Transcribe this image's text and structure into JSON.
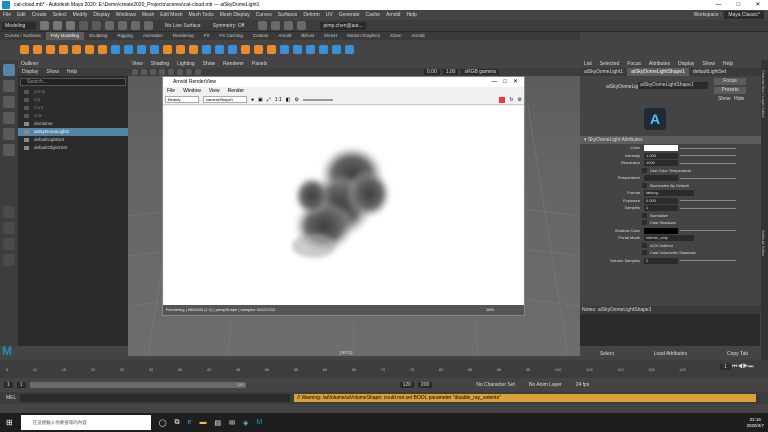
{
  "window": {
    "title": "cat-cloud.mb* - Autodesk Maya 2020: E:\\Demo\\create2020_Projects\\scenes\\cat-cloud.mb --- aiSkyDomeLight1",
    "minimize": "—",
    "maximize": "□",
    "close": "✕"
  },
  "menubar": [
    "File",
    "Edit",
    "Create",
    "Select",
    "Modify",
    "Display",
    "Windows",
    "Mesh",
    "Edit Mesh",
    "Mesh Tools",
    "Mesh Display",
    "Curves",
    "Surfaces",
    "Deform",
    "UV",
    "Generate",
    "Cache",
    "Arnold",
    "Help"
  ],
  "workspace": {
    "label": "Workspace :",
    "value": "Maya Classic*"
  },
  "status": {
    "menuset": "Modeling",
    "surface": "No Live Surface",
    "symmetry": "Symmetry: Off",
    "user": "pimp.chen@aut..."
  },
  "shelf": {
    "tabs": [
      "Curves / Surfaces",
      "Poly Modeling",
      "Sculpting",
      "Rigging",
      "Animation",
      "Rendering",
      "FX",
      "FX Caching",
      "Custom",
      "Arnold",
      "Bifrost",
      "MASH",
      "Motion Graphics",
      "XGen",
      "Arnold"
    ],
    "active": 1
  },
  "outliner": {
    "title": "Outliner",
    "menu": [
      "Display",
      "Show",
      "Help"
    ],
    "search": "Search...",
    "items": [
      {
        "label": "persp",
        "state": "dim"
      },
      {
        "label": "top",
        "state": "dim"
      },
      {
        "label": "front",
        "state": "dim"
      },
      {
        "label": "side",
        "state": "dim"
      },
      {
        "label": "aiVolume",
        "state": "lit"
      },
      {
        "label": "aiSkyDomeLight1",
        "state": "on"
      },
      {
        "label": "defaultLightSet",
        "state": "lit"
      },
      {
        "label": "defaultObjectSet",
        "state": "lit"
      }
    ]
  },
  "viewport": {
    "menu": [
      "View",
      "Shading",
      "Lighting",
      "Show",
      "Renderer",
      "Panels"
    ],
    "camera_label": "persp",
    "exposure": "0.00",
    "gamma": "1.00",
    "colorspace": "sRGB gamma"
  },
  "renderview": {
    "title": "Arnold RenderView",
    "menu": [
      "File",
      "Window",
      "View",
      "Render"
    ],
    "mode": "Beauty",
    "camera": "cameraShape1",
    "ratio": "1:1",
    "status": "Rendering | 960x540 (1:1) | perspShape | samples 3/2/2/2/2/2",
    "zoom": "16%"
  },
  "attr_editor": {
    "menu": [
      "List",
      "Selected",
      "Focus",
      "Attributes",
      "Display",
      "Show",
      "Help"
    ],
    "tabs": [
      "aiSkyDomeLight1",
      "aiSkyDomeLightShape1",
      "defaultLightSet"
    ],
    "active_tab": 1,
    "node_label": "aiSkyDomeLight:",
    "node_value": "aiSkyDomeLightShape1",
    "btn_focus": "Focus",
    "btn_presets": "Presets",
    "btn_show": "Show",
    "btn_hide": "Hide",
    "section": "SkyDomeLight Attributes",
    "rows": [
      {
        "label": "Color",
        "field": "",
        "kind": "color"
      },
      {
        "label": "Intensity",
        "field": "1.000",
        "kind": "slider"
      },
      {
        "label": "Resolution",
        "field": "1000",
        "kind": "slider"
      },
      {
        "label": "",
        "field": "Use Color Temperature",
        "kind": "check"
      },
      {
        "label": "Temperature",
        "field": "",
        "kind": "slider"
      },
      {
        "label": "",
        "field": "Illuminates By Default",
        "kind": "check"
      },
      {
        "label": "Format",
        "field": "latlong",
        "kind": "menu"
      },
      {
        "label": "Exposure",
        "field": "0.000",
        "kind": "slider"
      },
      {
        "label": "Samples",
        "field": "1",
        "kind": "slider"
      },
      {
        "label": "",
        "field": "Normalize",
        "kind": "check"
      },
      {
        "label": "",
        "field": "Cast Shadows",
        "kind": "check"
      },
      {
        "label": "Shadow Color",
        "field": "",
        "kind": "color"
      },
      {
        "label": "Portal Mode",
        "field": "interior_only",
        "kind": "menu"
      },
      {
        "label": "",
        "field": "AOV Indirect",
        "kind": "check"
      },
      {
        "label": "",
        "field": "Cast Volumetric Shadows",
        "kind": "check"
      },
      {
        "label": "Volume Samples",
        "field": "2",
        "kind": "slider"
      }
    ],
    "notes_label": "Notes: aiSkyDomeLightShape1",
    "btn_select": "Select",
    "btn_load": "Load Attributes",
    "btn_copy": "Copy Tab"
  },
  "timeline": {
    "ticks": [
      "5",
      "10",
      "15",
      "20",
      "25",
      "30",
      "35",
      "40",
      "45",
      "50",
      "55",
      "60",
      "65",
      "70",
      "75",
      "80",
      "85",
      "90",
      "95",
      "100",
      "105",
      "110",
      "115",
      "120"
    ],
    "current": "1"
  },
  "range": {
    "start": "1",
    "start2": "1",
    "end_inner": "120",
    "end": "120",
    "end2": "200",
    "character": "No Character Set",
    "anim_layer": "No Anim Layer",
    "fps": "24 fps"
  },
  "commandline": {
    "lang": "MEL",
    "warning": "// Warning: /aiVolume/aiVolumeShape: could not set BOOL parameter \"disable_ray_extents\""
  },
  "taskbar": {
    "search": "在這裡輸入你要搜尋的內容",
    "time": "22:16",
    "date": "2020/4/7"
  },
  "colors": {
    "accent": "#5285a6",
    "arnold_red": "#e53b3b"
  }
}
